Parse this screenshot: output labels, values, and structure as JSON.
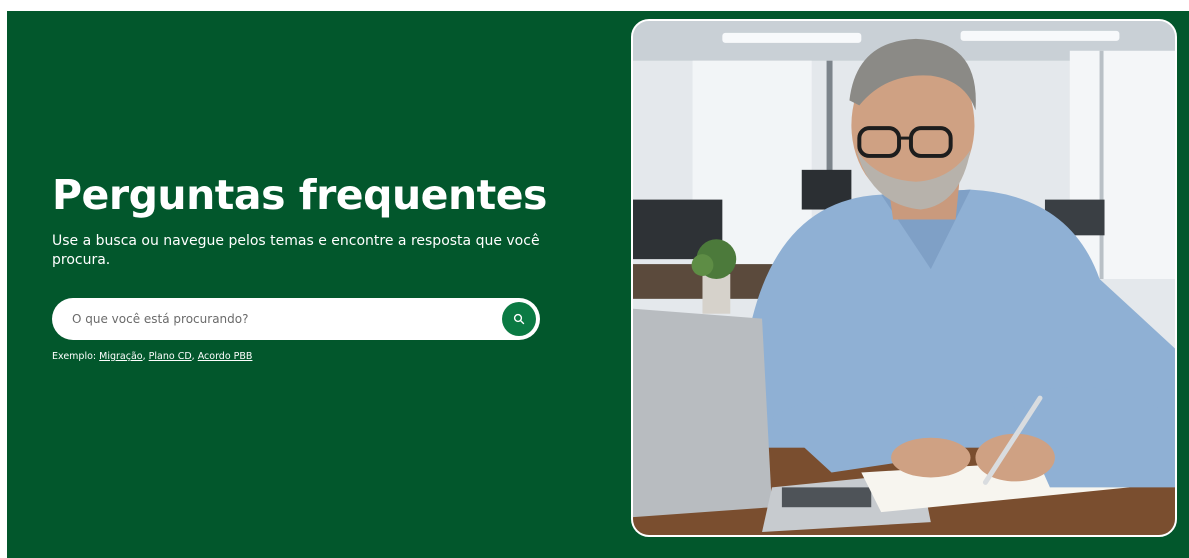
{
  "hero": {
    "title": "Perguntas frequentes",
    "subtitle": "Use a busca ou navegue pelos temas e encontre a resposta que você procura.",
    "search": {
      "placeholder": "O que você está procurando?"
    },
    "examples": {
      "prefix": "Exemplo:",
      "links": [
        "Migração",
        "Plano CD",
        "Acordo PBB"
      ]
    }
  },
  "colors": {
    "hero_bg": "#02572c",
    "search_button": "#0b7a43"
  },
  "icons": {
    "search_button": "search-icon"
  }
}
